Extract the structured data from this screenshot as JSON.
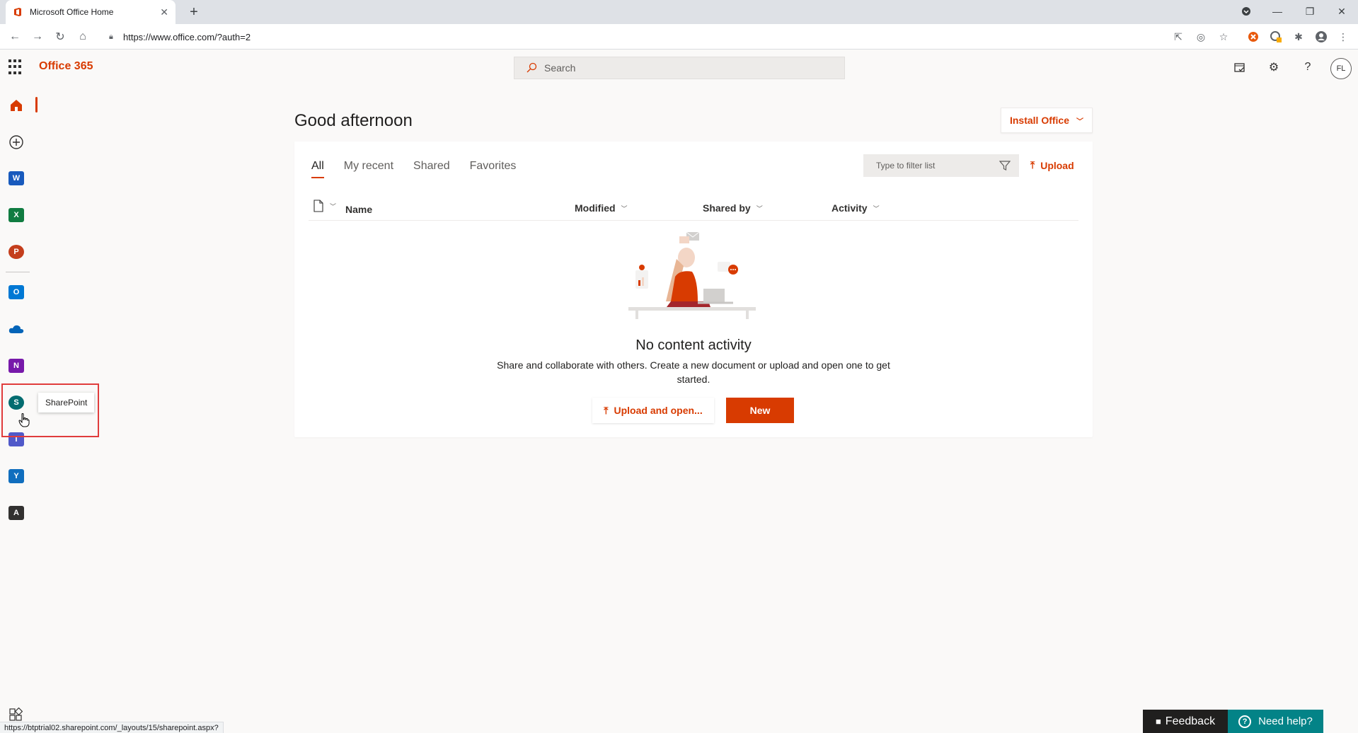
{
  "browser": {
    "tab_title": "Microsoft Office Home",
    "url": "https://www.office.com/?auth=2",
    "status_url": "https://btptrial02.sharepoint.com/_layouts/15/sharepoint.aspx?"
  },
  "header": {
    "brand": "Office 365",
    "search_placeholder": "Search",
    "avatar_initials": "FL"
  },
  "rail": {
    "items": [
      {
        "name": "Home",
        "icon": "home-icon"
      },
      {
        "name": "Create",
        "icon": "add-circle-icon"
      },
      {
        "name": "Word",
        "icon": "word-icon",
        "letter": "W",
        "color": "#185abd"
      },
      {
        "name": "Excel",
        "icon": "excel-icon",
        "letter": "X",
        "color": "#107c41"
      },
      {
        "name": "PowerPoint",
        "icon": "powerpoint-icon",
        "letter": "P",
        "color": "#c43e1c"
      },
      {
        "name": "Outlook",
        "icon": "outlook-icon",
        "letter": "O",
        "color": "#0078d4"
      },
      {
        "name": "OneDrive",
        "icon": "onedrive-icon",
        "color": "#0364b8"
      },
      {
        "name": "OneNote",
        "icon": "onenote-icon",
        "letter": "N",
        "color": "#7719aa"
      },
      {
        "name": "SharePoint",
        "icon": "sharepoint-icon",
        "letter": "S",
        "color": "#036c70"
      },
      {
        "name": "Teams",
        "icon": "teams-icon",
        "color": "#5059c9"
      },
      {
        "name": "Yammer",
        "icon": "yammer-icon",
        "letter": "Y",
        "color": "#106ebe"
      },
      {
        "name": "Admin",
        "icon": "admin-icon",
        "letter": "A",
        "color": "#323130"
      }
    ],
    "tooltip": "SharePoint"
  },
  "main": {
    "greeting": "Good afternoon",
    "install_label": "Install Office",
    "tabs": [
      {
        "label": "All",
        "active": true
      },
      {
        "label": "My recent",
        "active": false
      },
      {
        "label": "Shared",
        "active": false
      },
      {
        "label": "Favorites",
        "active": false
      }
    ],
    "filter_placeholder": "Type to filter list",
    "upload_label": "Upload",
    "columns": [
      "Name",
      "Modified",
      "Shared by",
      "Activity"
    ],
    "empty_title": "No content activity",
    "empty_desc": "Share and collaborate with others. Create a new document or upload and open one to get started.",
    "upload_open_label": "Upload and open...",
    "new_label": "New"
  },
  "footer": {
    "feedback_label": "Feedback",
    "help_label": "Need help?"
  },
  "colors": {
    "accent": "#d83b01",
    "help_bg": "#038387"
  }
}
